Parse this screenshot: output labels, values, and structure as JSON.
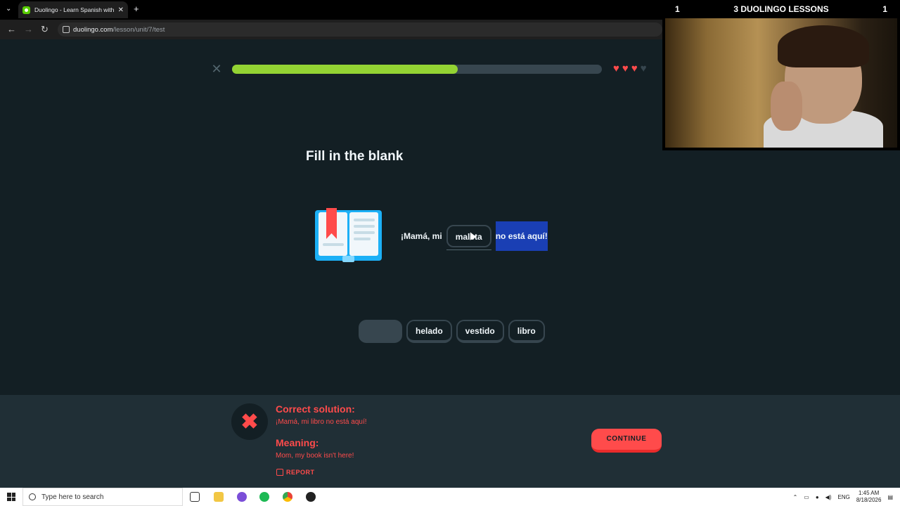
{
  "browser": {
    "tab_title": "Duolingo - Learn Spanish with I",
    "url_host": "duolingo.com",
    "url_path": "/lesson/unit/7/test"
  },
  "lesson": {
    "progress": 0.61,
    "hearts_filled": 3,
    "prompt": "Fill in the blank",
    "sentence_before": "¡Mamá, mi",
    "selected_word": "maleta",
    "sentence_after": "no está aquí!",
    "word_bank": [
      "helado",
      "vestido",
      "libro"
    ]
  },
  "feedback": {
    "solution_heading": "Correct solution:",
    "solution_text": "¡Mamá, mi libro no está aquí!",
    "meaning_heading": "Meaning:",
    "meaning_text": "Mom, my book isn't here!",
    "report_label": "REPORT",
    "continue_label": "CONTINUE"
  },
  "overlay": {
    "left_count": "1",
    "title": "3 DUOLINGO LESSONS",
    "right_count": "1"
  },
  "taskbar": {
    "search_placeholder": "Type here to search",
    "lang": "ENG",
    "time": "1:45 AM",
    "date": "8/18/2026"
  }
}
